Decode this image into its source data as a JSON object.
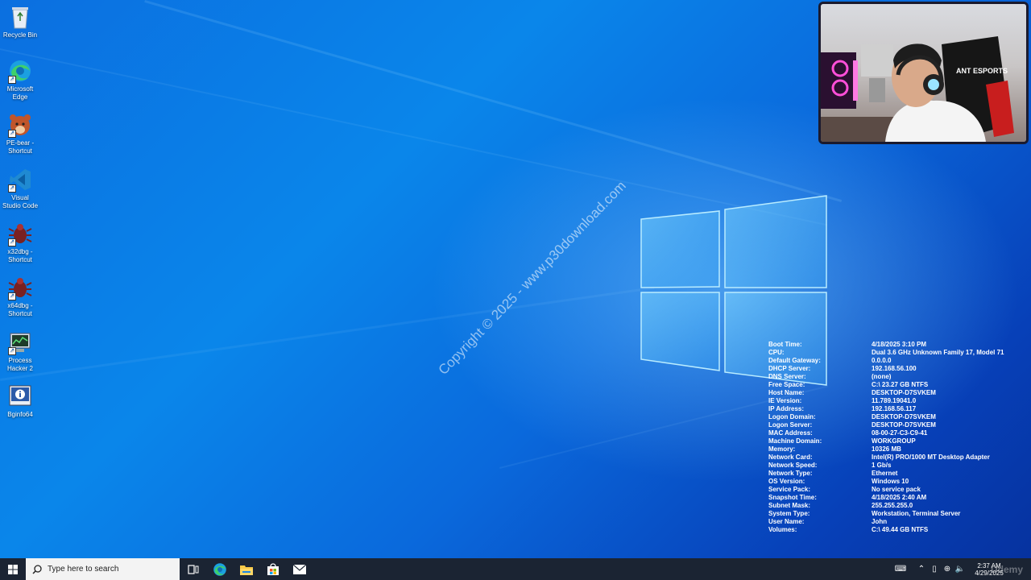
{
  "desktop_icons": [
    {
      "label": "Recycle Bin",
      "icon": "recycle-bin-icon"
    },
    {
      "label": "Microsoft Edge",
      "icon": "edge-icon"
    },
    {
      "label": "PE-bear - Shortcut",
      "icon": "pe-bear-icon"
    },
    {
      "label": "Visual Studio Code",
      "icon": "vscode-icon"
    },
    {
      "label": "x32dbg - Shortcut",
      "icon": "x32dbg-icon"
    },
    {
      "label": "x64dbg - Shortcut",
      "icon": "x64dbg-icon"
    },
    {
      "label": "Process Hacker 2",
      "icon": "process-hacker-icon"
    },
    {
      "label": "Bginfo64",
      "icon": "bginfo-icon"
    }
  ],
  "watermark": "Copyright © 2025 - www.p30download.com",
  "sysinfo": [
    {
      "key": "Boot Time:",
      "value": "4/18/2025 3:10 PM"
    },
    {
      "key": "CPU:",
      "value": "Dual 3.6 GHz Unknown Family 17, Model 71"
    },
    {
      "key": "Default Gateway:",
      "value": "0.0.0.0"
    },
    {
      "key": "DHCP Server:",
      "value": "192.168.56.100"
    },
    {
      "key": "DNS Server:",
      "value": "(none)"
    },
    {
      "key": "Free Space:",
      "value": "C:\\ 23.27 GB NTFS"
    },
    {
      "key": "Host Name:",
      "value": "DESKTOP-D7SVKEM"
    },
    {
      "key": "IE Version:",
      "value": "11.789.19041.0"
    },
    {
      "key": "IP Address:",
      "value": "192.168.56.117"
    },
    {
      "key": "Logon Domain:",
      "value": "DESKTOP-D7SVKEM"
    },
    {
      "key": "Logon Server:",
      "value": "DESKTOP-D7SVKEM"
    },
    {
      "key": "MAC Address:",
      "value": "08-00-27-C3-C9-41"
    },
    {
      "key": "Machine Domain:",
      "value": "WORKGROUP"
    },
    {
      "key": "Memory:",
      "value": "10326 MB"
    },
    {
      "key": "Network Card:",
      "value": "Intel(R) PRO/1000 MT Desktop Adapter"
    },
    {
      "key": "Network Speed:",
      "value": "1 Gb/s"
    },
    {
      "key": "Network Type:",
      "value": "Ethernet"
    },
    {
      "key": "OS Version:",
      "value": "Windows 10"
    },
    {
      "key": "Service Pack:",
      "value": "No service pack"
    },
    {
      "key": "Snapshot Time:",
      "value": "4/18/2025 2:40 AM"
    },
    {
      "key": "Subnet Mask:",
      "value": "255.255.255.0"
    },
    {
      "key": "System Type:",
      "value": "Workstation, Terminal Server"
    },
    {
      "key": "User Name:",
      "value": "John"
    },
    {
      "key": "Volumes:",
      "value": "C:\\ 49.44 GB NTFS"
    }
  ],
  "webcam": {
    "headset_brand": "ANT ESPORTS"
  },
  "taskbar": {
    "search_placeholder": "Type here to search",
    "apps": [
      {
        "icon": "task-view-icon"
      },
      {
        "icon": "edge-icon"
      },
      {
        "icon": "file-explorer-icon"
      },
      {
        "icon": "microsoft-store-icon"
      },
      {
        "icon": "mail-icon"
      }
    ],
    "clock_time": "2:37 AM",
    "clock_date": "4/29/2025",
    "brand_watermark": "Udemy"
  },
  "colors": {
    "accent": "#0a78e6",
    "taskbar": "#1b2433"
  }
}
